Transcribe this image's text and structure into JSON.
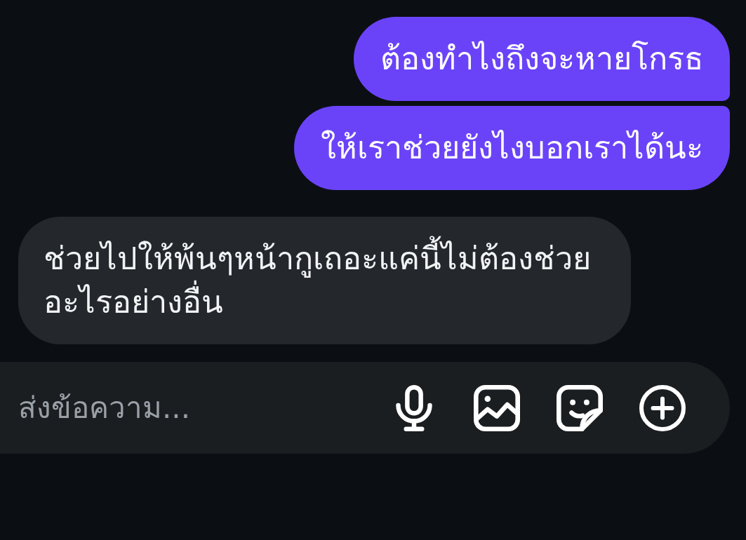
{
  "messages": [
    {
      "text": "ต้องทำไงถึงจะหายโกรธ",
      "kind": "outgoing"
    },
    {
      "text": "ให้เราช่วยยังไงบอกเราได้นะ",
      "kind": "outgoing"
    },
    {
      "text": "ช่วยไปให้พ้นๆหน้ากูเถอะแค่นี้ไม่ต้องช่วยอะไรอย่างอื่น",
      "kind": "incoming"
    }
  ],
  "composer": {
    "placeholder": "ส่งข้อความ..."
  }
}
